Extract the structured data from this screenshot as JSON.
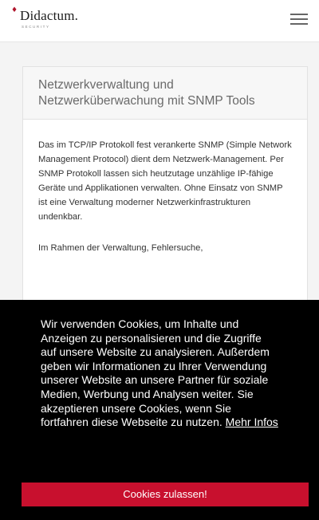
{
  "header": {
    "logo_mark": "♦",
    "logo_name": "Didactum.",
    "logo_sub": "SECURITY",
    "menu_icon": "hamburger-menu-icon"
  },
  "article": {
    "title": "Netzwerkverwaltung und Netzwerküberwachung mit SNMP Tools",
    "paragraphs": [
      "Das im TCP/IP Protokoll fest verankerte SNMP (Simple Network Management Protocol) dient dem Netzwerk-Management. Per SNMP Protokoll lassen sich heutzutage unzählige IP-fähige Geräte und Applikationen verwalten. Ohne Einsatz von SNMP ist eine Verwaltung moderner Netzwerkinfrastrukturen undenkbar.",
      "Im Rahmen der Verwaltung, Fehlersuche,"
    ]
  },
  "cookie_banner": {
    "text": "Wir verwenden Cookies, um Inhalte und Anzeigen zu personalisieren und die Zugriffe auf unsere Website zu analysieren. Außerdem geben wir Informationen zu Ihrer Verwendung unserer Website an unsere Partner für soziale Medien, Werbung und Analysen weiter. Sie akzeptieren unsere Cookies, wenn Sie fortfahren diese Webseite zu nutzen.",
    "link_label": "Mehr Infos",
    "button_label": "Cookies zulassen!"
  },
  "colors": {
    "brand_red": "#c8102e",
    "banner_bg": "#000000",
    "page_bg": "#f4f4f4"
  }
}
